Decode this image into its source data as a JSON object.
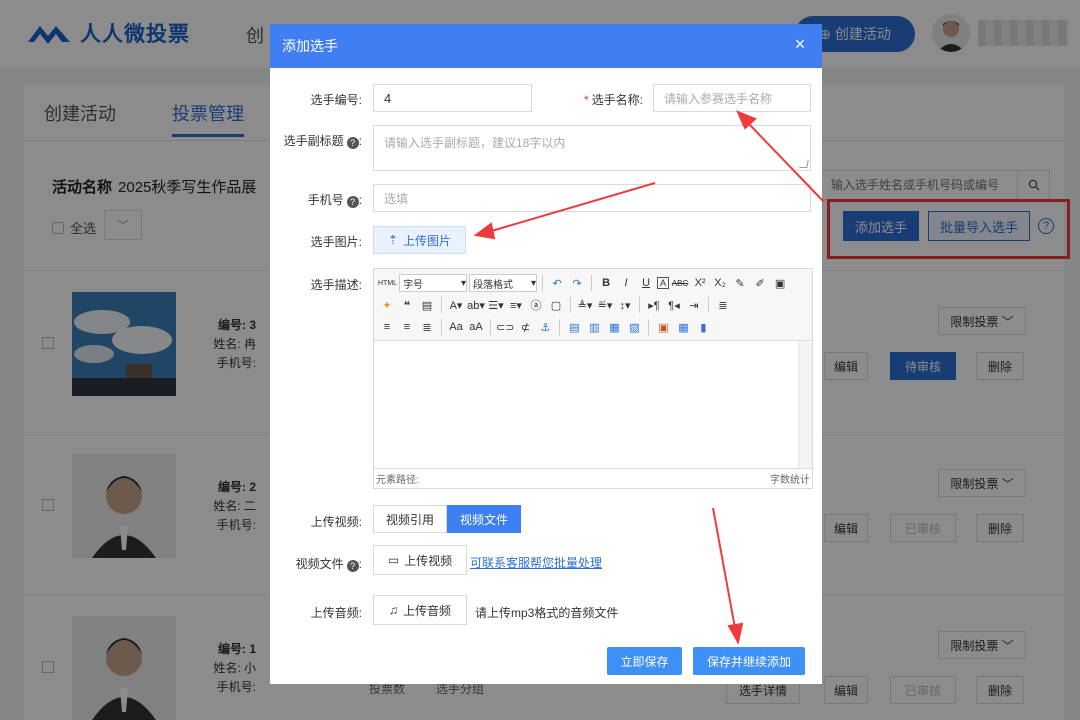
{
  "app": {
    "logo_text": "人人微投票",
    "nav_create": "创",
    "create_activity_label": "创建活动"
  },
  "tabs": [
    {
      "label": "创建活动"
    },
    {
      "label": "投票管理"
    }
  ],
  "activity": {
    "name_label": "活动名称",
    "name_value": "2025秋季写生作品展",
    "select_all": "全选",
    "search_placeholder": "输入选手姓名或手机号码或编号",
    "add_player_label": "添加选手",
    "batch_import_label": "批量导入选手"
  },
  "rows": [
    {
      "number": "编号: 3",
      "name": "姓名: 冉",
      "phone": "手机号:",
      "limit": "限制投票",
      "edit": "编辑",
      "status": "待审核",
      "delete": "删除"
    },
    {
      "number": "编号: 2",
      "name": "姓名: 二",
      "phone": "手机号:",
      "limit": "限制投票",
      "edit": "编辑",
      "status": "已审核",
      "delete": "删除"
    },
    {
      "number": "编号: 1",
      "name": "姓名: 小",
      "phone": "手机号:",
      "limit": "限制投票",
      "detail": "选手详情",
      "edit": "编辑",
      "status": "已审核",
      "delete": "删除",
      "votes": "投票数",
      "group": "选手分组"
    }
  ],
  "modal": {
    "title": "添加选手",
    "fields": {
      "number_label": "选手编号:",
      "number_value": "4",
      "name_label": "选手名称:",
      "name_placeholder": "请输入参赛选手名称",
      "subtitle_label": "选手副标题",
      "subtitle_placeholder": "请输入选手副标题，建议18字以内",
      "phone_label": "手机号",
      "phone_placeholder": "选填",
      "image_label": "选手图片:",
      "upload_image": "上传图片",
      "desc_label": "选手描述:",
      "video_label": "上传视频:",
      "video_ref": "视频引用",
      "video_file": "视频文件",
      "video_file_label": "视频文件",
      "upload_video": "上传视频",
      "contact_link": "可联系客服帮您批量处理",
      "audio_label": "上传音频:",
      "upload_audio": "上传音频",
      "audio_hint": "请上传mp3格式的音频文件"
    },
    "editor": {
      "font_select": "字号",
      "para_select": "段落格式",
      "path_label": "元素路径:",
      "word_count": "字数统计"
    },
    "buttons": {
      "save_now": "立即保存",
      "save_continue": "保存并继续添加"
    }
  },
  "colors": {
    "primary": "#2d6fd6",
    "modal_header": "#3f7ff1",
    "annotation": "#ee3a3a"
  }
}
